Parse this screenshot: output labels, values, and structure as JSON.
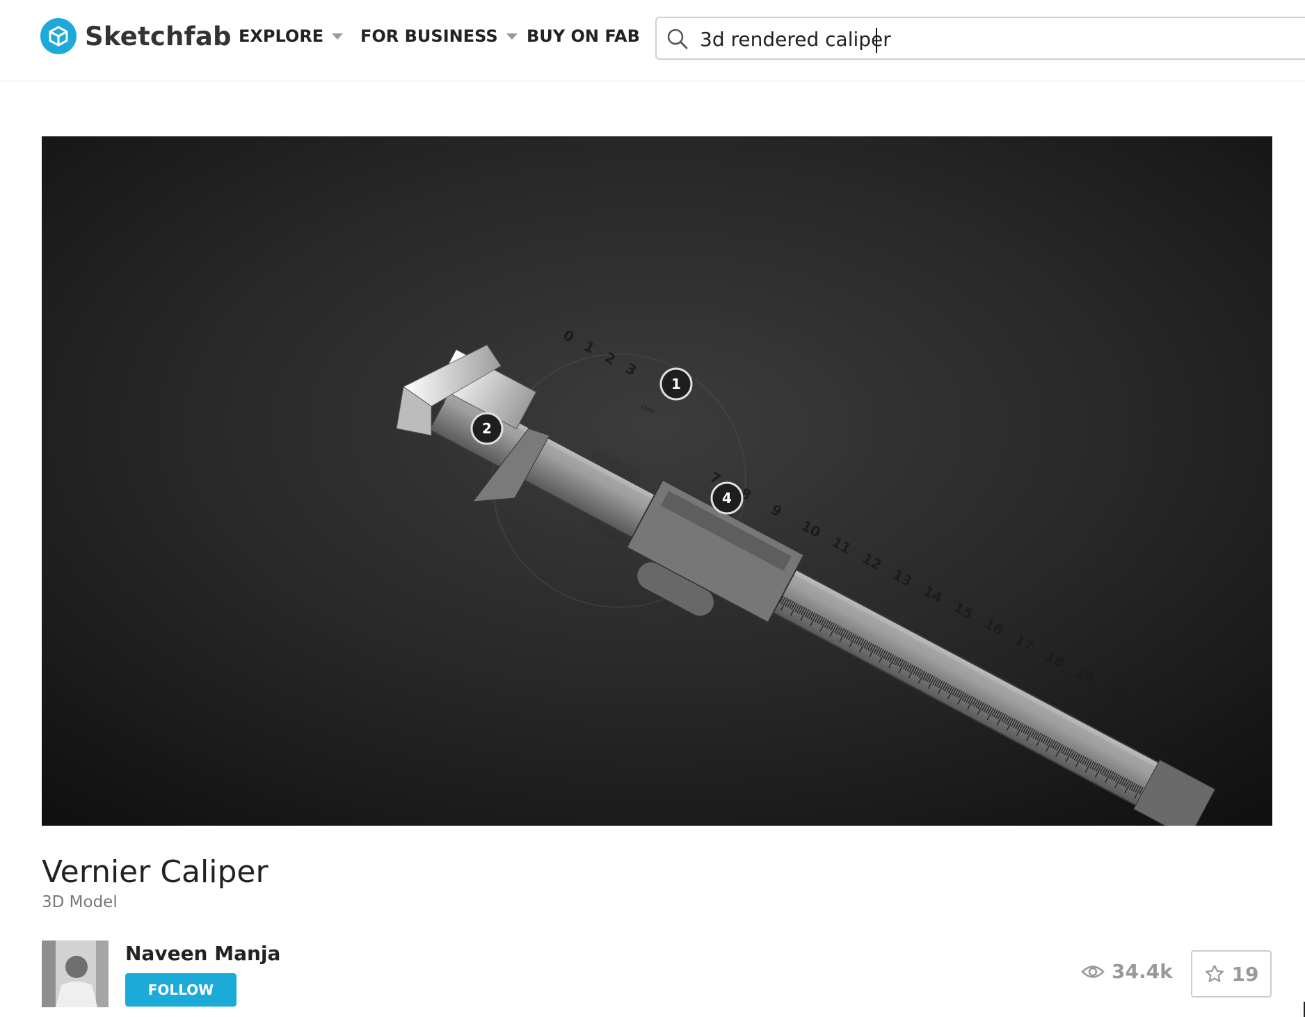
{
  "brand": {
    "name": "Sketchfab",
    "icon": "sketchfab-logo-icon",
    "accent_color": "#1caad9"
  },
  "nav": {
    "explore": "EXPLORE",
    "for_business": "FOR BUSINESS",
    "buy_on_fab": "BUY ON FAB"
  },
  "search": {
    "value": "3d rendered caliper",
    "icon": "search-icon"
  },
  "viewer": {
    "hotspots": [
      "1",
      "2",
      "4"
    ],
    "ruler_labels": [
      "0",
      "1",
      "2",
      "3",
      "7",
      "8",
      "9",
      "10",
      "11",
      "12",
      "13",
      "14",
      "15",
      "16",
      "17",
      "18",
      "19",
      "20"
    ],
    "unit_label": "1MM"
  },
  "model": {
    "title": "Vernier Caliper",
    "subtitle": "3D Model"
  },
  "author": {
    "name": "Naveen Manja",
    "follow_label": "FOLLOW"
  },
  "stats": {
    "views": "34.4k",
    "likes": "19",
    "views_icon": "eye-icon",
    "likes_icon": "star-icon"
  }
}
